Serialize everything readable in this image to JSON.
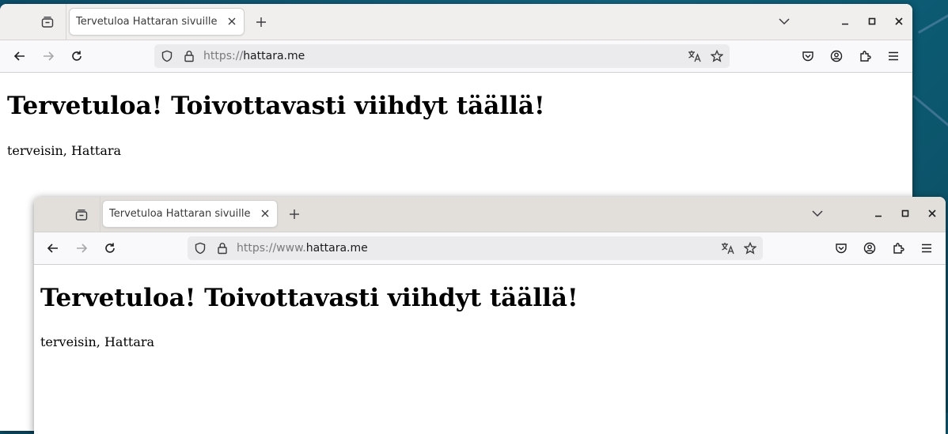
{
  "colors": {
    "desktop": "#0c4f6a",
    "titlebar_front": "#f0efee",
    "titlebar_back": "#e2dfdb",
    "navbar": "#f9f9fb",
    "urlbar": "#ebebed",
    "icon": "#3a3a3e"
  },
  "window_back": {
    "tab": {
      "title": "Tervetuloa Hattaran sivuille"
    },
    "urlbar": {
      "prefix": "https://",
      "host": "hattara.me"
    },
    "page": {
      "heading": "Tervetuloa! Toivottavasti viihdyt täällä!",
      "greeting": "terveisin, Hattara"
    }
  },
  "window_front": {
    "tab": {
      "title": "Tervetuloa Hattaran sivuille"
    },
    "urlbar": {
      "prefix": "https://www.",
      "host": "hattara.me"
    },
    "page": {
      "heading": "Tervetuloa! Toivottavasti viihdyt täällä!",
      "greeting": "terveisin, Hattara"
    }
  },
  "icons": {
    "tabs_overview": "tabs-overview-icon",
    "close_tab": "close-icon",
    "new_tab": "plus-icon",
    "list_all_tabs": "chevron-down-icon",
    "minimize": "minimize-icon",
    "maximize": "maximize-icon",
    "close_window": "close-icon",
    "back": "back-arrow-icon",
    "forward": "forward-arrow-icon",
    "reload": "reload-icon",
    "shield": "shield-icon",
    "lock": "lock-icon",
    "translate": "translate-icon",
    "bookmark": "star-icon",
    "pocket": "pocket-icon",
    "account": "account-icon",
    "extensions": "puzzle-icon",
    "menu": "hamburger-menu-icon"
  }
}
